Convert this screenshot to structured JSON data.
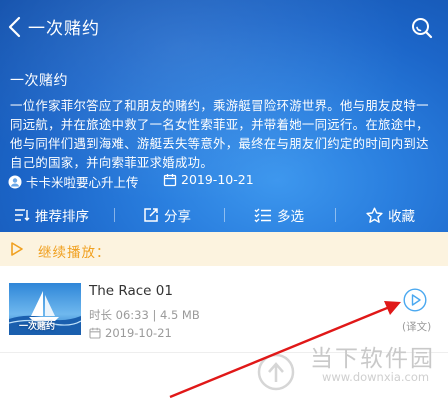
{
  "header": {
    "title": "一次赌约"
  },
  "episode": {
    "title": "一次赌约",
    "description": "一位作家菲尔答应了和朋友的赌约，乘游艇冒险环游世界。他与朋友皮特一同远航，并在旅途中救了一名女性索菲亚，并带着她一同远行。在旅途中，他与同伴们遇到海难、游艇丢失等意外，最终在与朋友们约定的时间内到达自己的国家，并向索菲亚求婚成功。",
    "uploader": "卡卡米啦要心升上传",
    "date": "2019-10-21"
  },
  "toolbar": {
    "sort_label": "推荐排序",
    "share_label": "分享",
    "multiselect_label": "多选",
    "favorite_label": "收藏"
  },
  "continue": {
    "label": "继续播放："
  },
  "items": [
    {
      "title": "The Race 01",
      "meta": "时长 06:33 | 4.5 MB",
      "date": "2019-10-21",
      "translate_label": "(译文)",
      "thumb_text": "一次赌约"
    }
  ],
  "watermark": {
    "name": "当下软件园",
    "url": "www.downxia.com"
  },
  "colors": {
    "header_blue": "#1c66c9",
    "accent_orange": "#f0a020",
    "play_blue": "#4aa8f0",
    "annotation_red": "#e01818"
  }
}
